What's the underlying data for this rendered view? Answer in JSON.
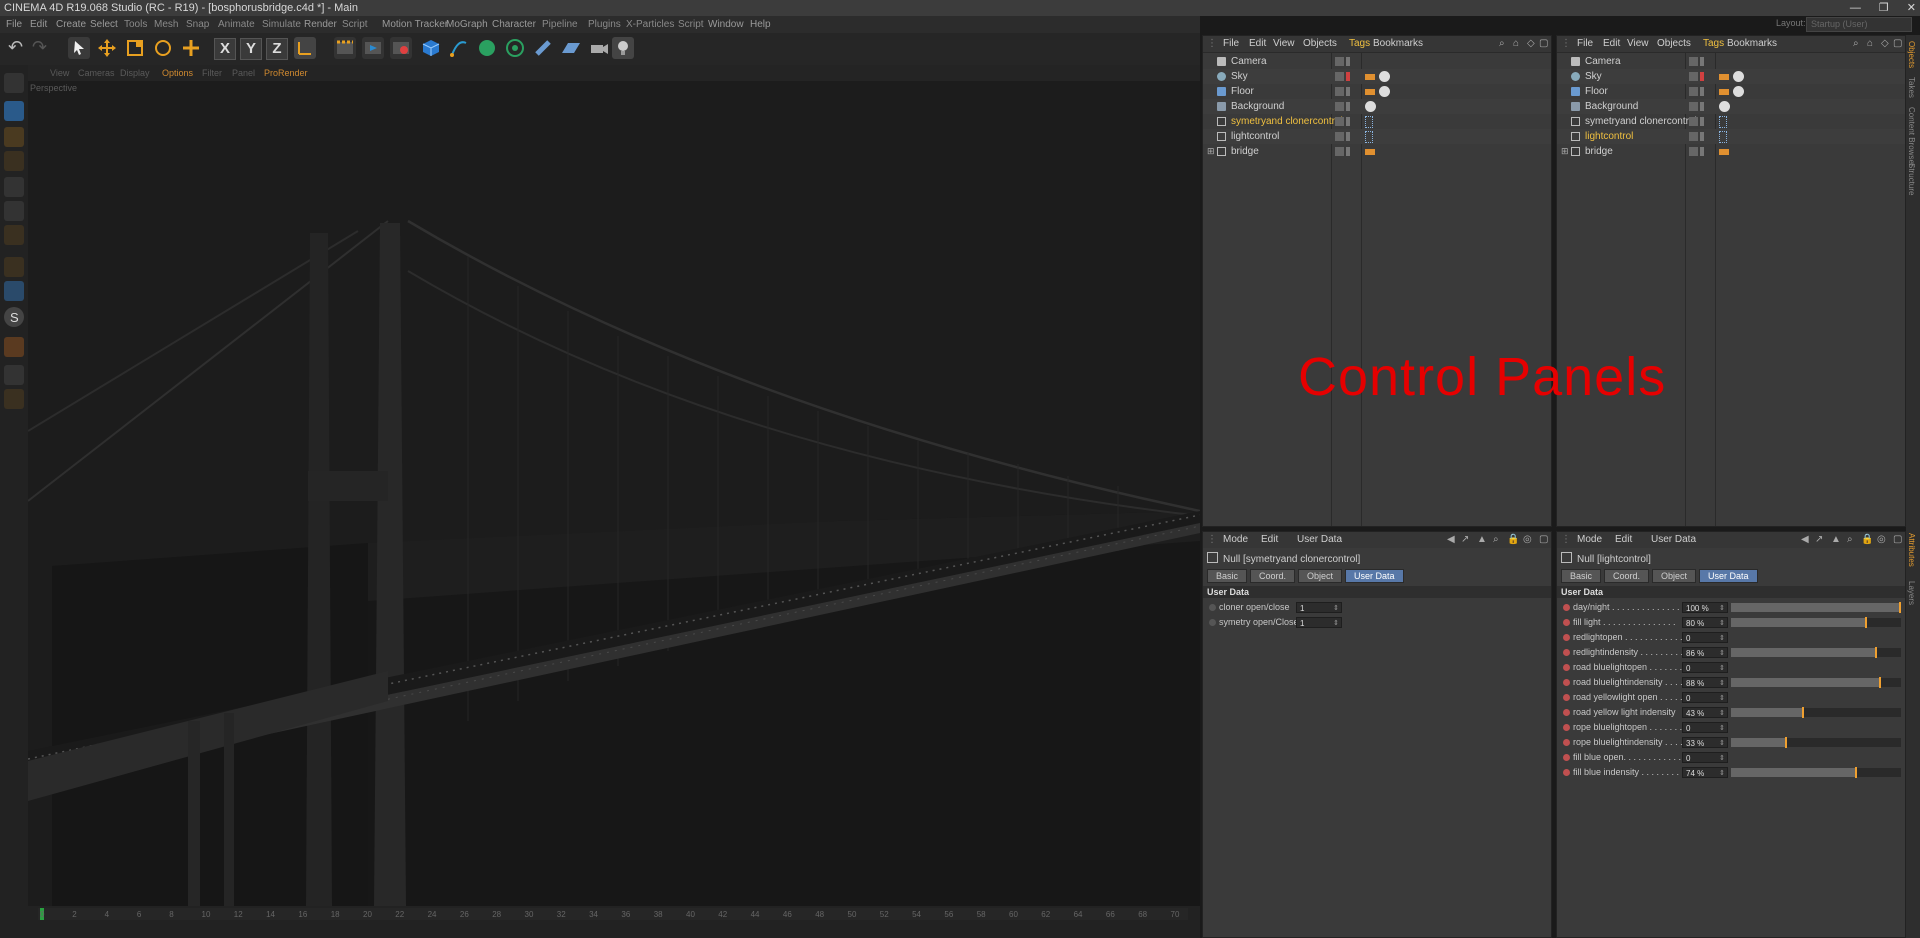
{
  "window": {
    "title": "CINEMA 4D R19.068 Studio (RC - R19) - [bosphorusbridge.c4d *] - Main",
    "minimize": "—",
    "restore": "❐",
    "close": "✕",
    "layout_label": "Layout:",
    "layout_value": "Startup (User)"
  },
  "menu": [
    "File",
    "Edit",
    "Create",
    "Select",
    "Tools",
    "Mesh",
    "Snap",
    "Animate",
    "Simulate",
    "Render",
    "Script",
    "Motion Tracker",
    "MoGraph",
    "Character",
    "Pipeline",
    "Plugins",
    "X-Particles",
    "Script",
    "Window",
    "Help"
  ],
  "viewport": {
    "menu": [
      "View",
      "Cameras",
      "Display",
      "Options",
      "Filter",
      "Panel",
      "ProRender"
    ],
    "label": "Perspective",
    "overlay_text": "Control Panels"
  },
  "timeline": {
    "ticks": [
      "0",
      "2",
      "4",
      "6",
      "8",
      "10",
      "12",
      "14",
      "16",
      "18",
      "20",
      "22",
      "24",
      "26",
      "28",
      "30",
      "32",
      "34",
      "36",
      "38",
      "40",
      "42",
      "44",
      "46",
      "48",
      "50",
      "52",
      "54",
      "56",
      "58",
      "60",
      "62",
      "64",
      "66",
      "68",
      "70"
    ]
  },
  "object_manager_left": {
    "menu": [
      "File",
      "Edit",
      "View",
      "Objects",
      "Tags",
      "Bookmarks"
    ],
    "active_menu": "Tags",
    "objects": [
      {
        "name": "Camera",
        "highlight": false
      },
      {
        "name": "Sky",
        "highlight": false
      },
      {
        "name": "Floor",
        "highlight": false
      },
      {
        "name": "Background",
        "highlight": false
      },
      {
        "name": "symetryand clonercontrol",
        "highlight": true
      },
      {
        "name": "lightcontrol",
        "highlight": false
      },
      {
        "name": "bridge",
        "highlight": false
      }
    ]
  },
  "object_manager_right": {
    "menu": [
      "File",
      "Edit",
      "View",
      "Objects",
      "Tags",
      "Bookmarks"
    ],
    "active_menu": "Tags",
    "objects": [
      {
        "name": "Camera",
        "highlight": false
      },
      {
        "name": "Sky",
        "highlight": false
      },
      {
        "name": "Floor",
        "highlight": false
      },
      {
        "name": "Background",
        "highlight": false
      },
      {
        "name": "symetryand clonercontrol",
        "highlight": false
      },
      {
        "name": "lightcontrol",
        "highlight": true
      },
      {
        "name": "bridge",
        "highlight": false
      }
    ]
  },
  "attr_left": {
    "menu": [
      "Mode",
      "Edit",
      "User Data"
    ],
    "title": "Null [symetryand clonercontrol]",
    "tabs": [
      "Basic",
      "Coord.",
      "Object",
      "User Data"
    ],
    "selected_tab": "User Data",
    "section": "User Data",
    "rows": [
      {
        "label": "cloner open/close",
        "value": "1"
      },
      {
        "label": "symetry open/Close",
        "value": "1"
      }
    ]
  },
  "attr_right": {
    "menu": [
      "Mode",
      "Edit",
      "User Data"
    ],
    "title": "Null [lightcontrol]",
    "tabs": [
      "Basic",
      "Coord.",
      "Object",
      "User Data"
    ],
    "selected_tab": "User Data",
    "section": "User Data",
    "rows": [
      {
        "label": "day/night . . . . . . . . . . . . . .",
        "value": "100 %",
        "level": 1.0
      },
      {
        "label": "fill light . . . . . . . . . . . . . . .",
        "value": "80 %",
        "level": 0.8
      },
      {
        "label": "redlightopen . . . . . . . . . . . .",
        "value": "0"
      },
      {
        "label": "redlightindensity . . . . . . . . .",
        "value": "86 %",
        "level": 0.86
      },
      {
        "label": "road bluelightopen . . . . . . .",
        "value": "0"
      },
      {
        "label": "road bluelightindensity . . . .",
        "value": "88 %",
        "level": 0.88
      },
      {
        "label": "road yellowlight open . . . . .",
        "value": "0"
      },
      {
        "label": "road yellow light indensity",
        "value": "43 %",
        "level": 0.43
      },
      {
        "label": "rope bluelightopen . . . . . . .",
        "value": "0"
      },
      {
        "label": "rope bluelightindensity . . . .",
        "value": "33 %",
        "level": 0.33
      },
      {
        "label": "fill blue open. . . . . . . . . . . .",
        "value": "0"
      },
      {
        "label": "fill blue indensity . . . . . . . .",
        "value": "74 %",
        "level": 0.74
      }
    ]
  },
  "right_side_tabs": [
    "Objects",
    "Takes",
    "Content Browser",
    "Structure"
  ],
  "right_side_tabs_lower": [
    "Attributes",
    "Layers"
  ]
}
